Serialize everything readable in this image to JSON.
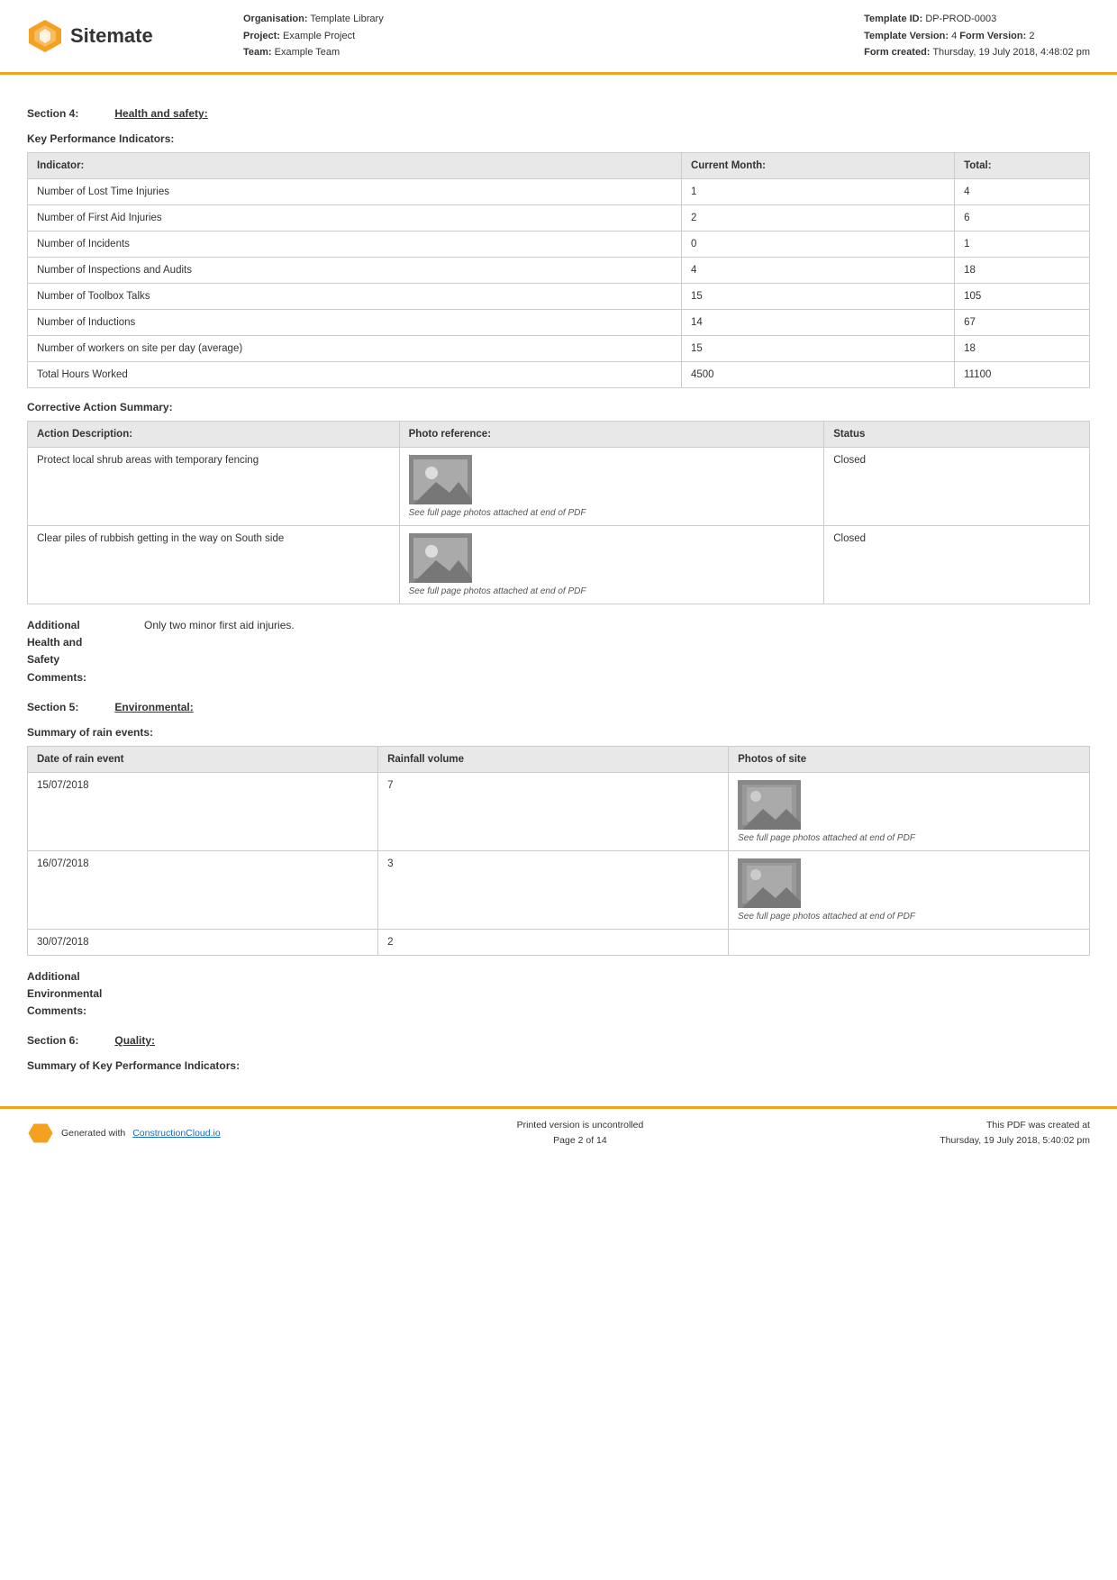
{
  "header": {
    "logo_text": "Sitemate",
    "org_label": "Organisation:",
    "org_value": "Template Library",
    "project_label": "Project:",
    "project_value": "Example Project",
    "team_label": "Team:",
    "team_value": "Example Team",
    "template_id_label": "Template ID:",
    "template_id_value": "DP-PROD-0003",
    "template_version_label": "Template Version:",
    "template_version_value": "4",
    "form_version_label": "Form Version:",
    "form_version_value": "2",
    "form_created_label": "Form created:",
    "form_created_value": "Thursday, 19 July 2018, 4:48:02 pm"
  },
  "section4": {
    "label": "Section 4:",
    "value": "Health and safety:"
  },
  "kpi_title": "Key Performance Indicators:",
  "kpi_table": {
    "headers": [
      "Indicator:",
      "Current Month:",
      "Total:"
    ],
    "rows": [
      [
        "Number of Lost Time Injuries",
        "1",
        "4"
      ],
      [
        "Number of First Aid Injuries",
        "2",
        "6"
      ],
      [
        "Number of Incidents",
        "0",
        "1"
      ],
      [
        "Number of Inspections and Audits",
        "4",
        "18"
      ],
      [
        "Number of Toolbox Talks",
        "15",
        "105"
      ],
      [
        "Number of Inductions",
        "14",
        "67"
      ],
      [
        "Number of workers on site per day (average)",
        "15",
        "18"
      ],
      [
        "Total Hours Worked",
        "4500",
        "11100"
      ]
    ]
  },
  "corrective_action_title": "Corrective Action Summary:",
  "corrective_table": {
    "headers": [
      "Action Description:",
      "Photo reference:",
      "Status"
    ],
    "rows": [
      {
        "description": "Protect local shrub areas with temporary fencing",
        "photo_caption": "See full page photos attached at end of PDF",
        "status": "Closed"
      },
      {
        "description": "Clear piles of rubbish getting in the way on South side",
        "photo_caption": "See full page photos attached at end of PDF",
        "status": "Closed"
      }
    ]
  },
  "additional_hs_label": "Additional\nHealth and\nSafety\nComments:",
  "additional_hs_value": "Only two minor first aid injuries.",
  "section5": {
    "label": "Section 5:",
    "value": "Environmental:"
  },
  "rain_events_title": "Summary of rain events:",
  "rain_table": {
    "headers": [
      "Date of rain event",
      "Rainfall volume",
      "Photos of site"
    ],
    "rows": [
      {
        "date": "15/07/2018",
        "volume": "7",
        "has_photo": true,
        "photo_caption": "See full page photos attached at end of PDF"
      },
      {
        "date": "16/07/2018",
        "volume": "3",
        "has_photo": true,
        "photo_caption": "See full page photos attached at end of PDF"
      },
      {
        "date": "30/07/2018",
        "volume": "2",
        "has_photo": false,
        "photo_caption": ""
      }
    ]
  },
  "additional_env_label": "Additional\nEnvironmental\nComments:",
  "additional_env_value": "",
  "section6": {
    "label": "Section 6:",
    "value": "Quality:"
  },
  "quality_kpi_title": "Summary of Key Performance Indicators:",
  "footer": {
    "generated_prefix": "Generated with ",
    "generated_link": "ConstructionCloud.io",
    "uncontrolled": "Printed version is uncontrolled",
    "page": "Page 2 of 14",
    "pdf_created_prefix": "This PDF was created at",
    "pdf_created_date": "Thursday, 19 July 2018, 5:40:02 pm"
  }
}
